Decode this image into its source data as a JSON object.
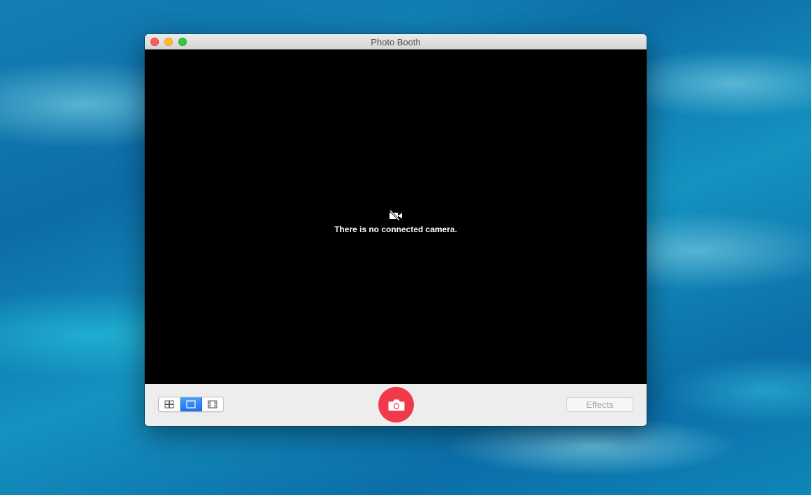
{
  "window": {
    "title": "Photo Booth"
  },
  "preview": {
    "message": "There is no connected camera.",
    "icon": "camera-off-icon"
  },
  "toolbar": {
    "view_modes": [
      {
        "name": "four-up",
        "icon": "grid-icon",
        "selected": false
      },
      {
        "name": "single-photo",
        "icon": "single-frame-icon",
        "selected": true
      },
      {
        "name": "movie-clip",
        "icon": "film-strip-icon",
        "selected": false
      }
    ],
    "shutter_icon": "camera-icon",
    "effects_label": "Effects",
    "effects_enabled": false
  },
  "colors": {
    "shutter": "#f0394a",
    "selected_segment": "#2a7ef4",
    "preview_bg": "#000000"
  }
}
